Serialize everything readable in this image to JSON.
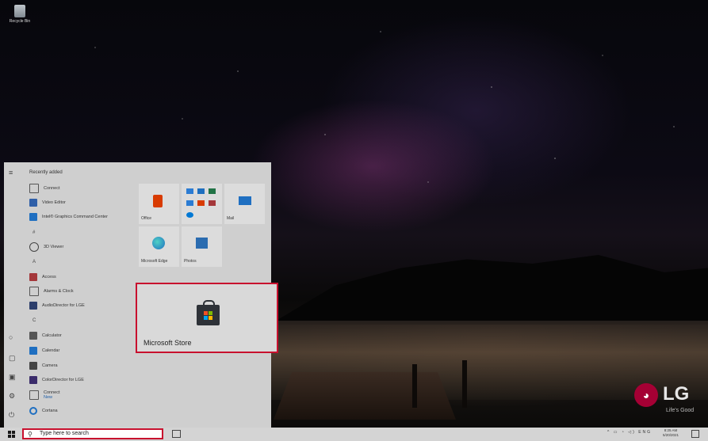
{
  "desktop": {
    "recycle_bin_label": "Recycle Bin",
    "brand_logo": "LG",
    "brand_tagline": "Life's Good"
  },
  "start_menu": {
    "section_header": "Recently added",
    "apps": [
      {
        "label": "Connect",
        "icon": "connect-icon",
        "color": "#555555"
      },
      {
        "label": "Video Editor",
        "icon": "video-editor-icon",
        "color": "#2f5fa8"
      },
      {
        "label": "Intel® Graphics Command Center",
        "icon": "intel-graphics-icon",
        "color": "#1f6fc1"
      },
      {
        "label": "#",
        "icon": "",
        "color": ""
      },
      {
        "label": "3D Viewer",
        "icon": "3d-viewer-icon",
        "color": "#444444"
      },
      {
        "label": "A",
        "icon": "",
        "color": ""
      },
      {
        "label": "Access",
        "icon": "access-icon",
        "color": "#a4373a"
      },
      {
        "label": "Alarms & Clock",
        "icon": "alarm-clock-icon",
        "color": "#555555"
      },
      {
        "label": "AudioDirector for LGE",
        "icon": "audiodirector-icon",
        "color": "#2c3e6b"
      },
      {
        "label": "C",
        "icon": "",
        "color": ""
      },
      {
        "label": "Calculator",
        "icon": "calculator-icon",
        "color": "#555555"
      },
      {
        "label": "Calendar",
        "icon": "calendar-icon",
        "color": "#1f6fc1"
      },
      {
        "label": "Camera",
        "icon": "camera-icon",
        "color": "#444444"
      },
      {
        "label": "ColorDirector for LGE",
        "icon": "colordirector-icon",
        "color": "#3b2c6b"
      },
      {
        "label": "Connect",
        "sub": "New",
        "icon": "connect-icon",
        "color": "#555555"
      },
      {
        "label": "Cortana",
        "icon": "cortana-icon",
        "color": "#1f6fc1"
      }
    ],
    "tiles": [
      {
        "label": "Office",
        "icon": "office-icon",
        "color": "#d83b01"
      },
      {
        "label": "",
        "icon": "office-apps-icon",
        "color": "#2b7cd3"
      },
      {
        "label": "Mail",
        "icon": "mail-icon",
        "color": "#1f6fc1"
      },
      {
        "label": "Microsoft Edge",
        "icon": "edge-icon",
        "color": "#1f8fb0"
      },
      {
        "label": "Photos",
        "icon": "photos-icon",
        "color": "#2b6cb0"
      }
    ],
    "highlight_tile": {
      "label": "Microsoft Store",
      "icon": "store-bag-icon"
    }
  },
  "taskbar": {
    "search_placeholder": "Type here to search",
    "language": "ENG",
    "time": "8:25 AM",
    "date": "5/20/2021"
  },
  "colors": {
    "highlight": "#c8102e",
    "lg_brand": "#a50034"
  }
}
